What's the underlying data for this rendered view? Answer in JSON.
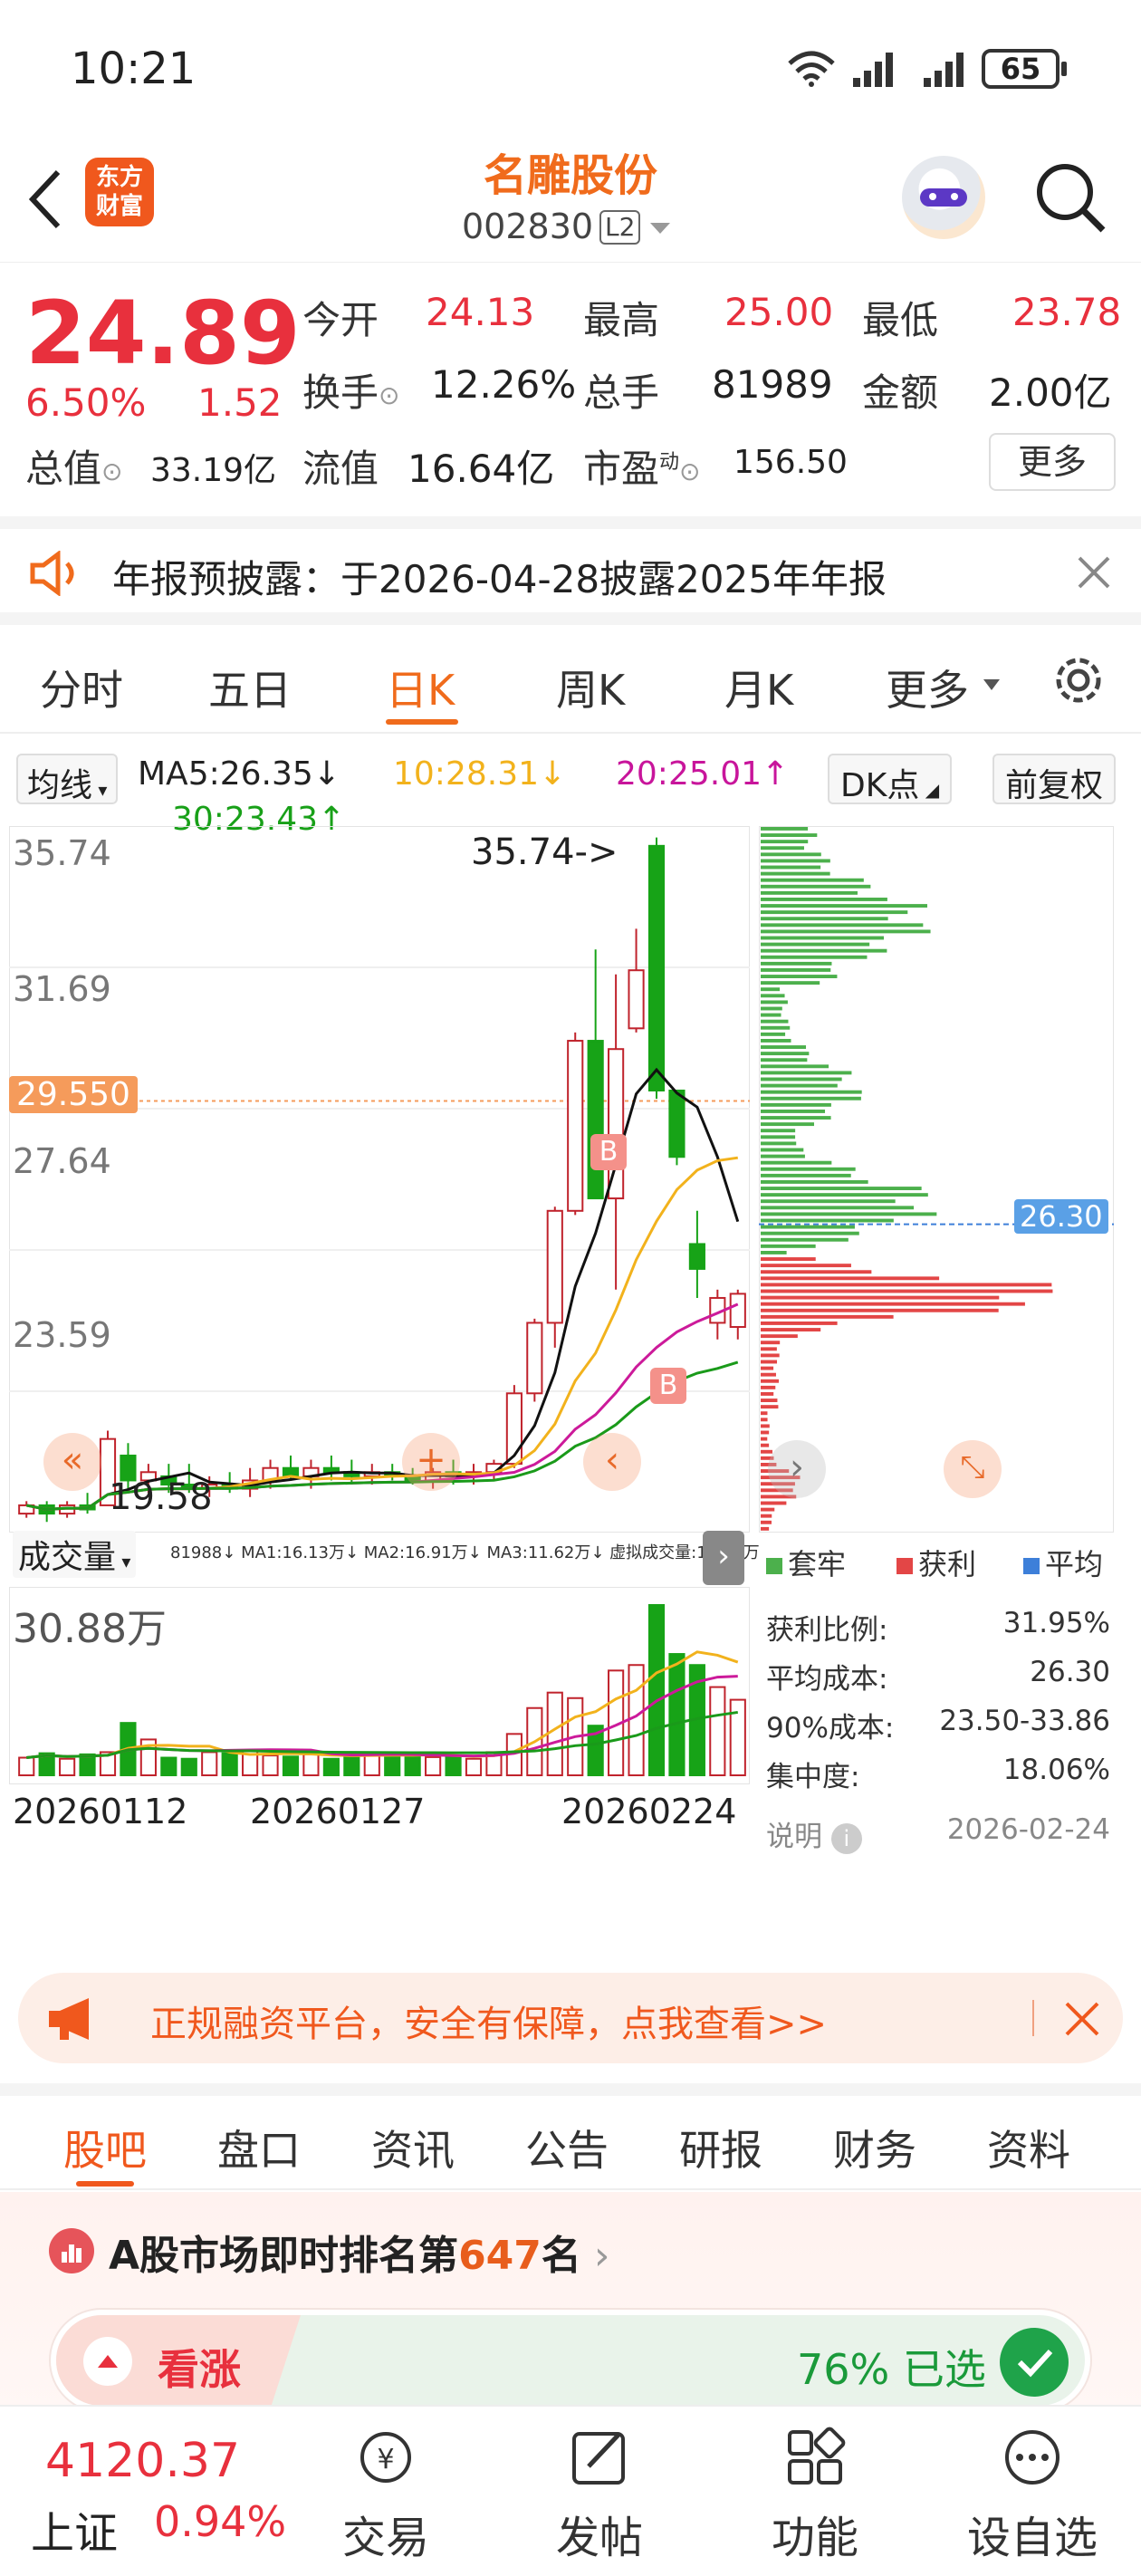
{
  "status": {
    "time": "10:21",
    "battery": "65"
  },
  "nav": {
    "title": "名雕股份",
    "code": "002830",
    "level": "L2",
    "logo_text1": "东方",
    "logo_text2": "财富"
  },
  "quote": {
    "price": "24.89",
    "pct": "6.50%",
    "chg": "1.52",
    "open_label": "今开",
    "open": "24.13",
    "high_label": "最高",
    "high": "25.00",
    "low_label": "最低",
    "low": "23.78",
    "turnover_label": "换手",
    "turnover": "12.26%",
    "vol_label": "总手",
    "vol": "81989",
    "amount_label": "金额",
    "amount": "2.00亿",
    "mcap_label": "总值",
    "mcap": "33.19亿",
    "float_label": "流值",
    "float": "16.64亿",
    "pe_label": "市盈",
    "pe_sup": "动",
    "pe": "156.50",
    "more": "更多"
  },
  "notice": {
    "text": "年报预披露：于2026-04-28披露2025年年报"
  },
  "tabs": [
    "分时",
    "五日",
    "日K",
    "周K",
    "月K",
    "更多"
  ],
  "chart": {
    "ma_select": "均线",
    "ma5": "MA5:26.35↓",
    "ma10": "10:28.31↓",
    "ma20": "20:25.01↑",
    "ma30": "30:23.43↑",
    "dk": "DK点",
    "fq": "前复权",
    "y_labels": [
      "35.74",
      "31.69",
      "27.64",
      "23.59"
    ],
    "cur_price": "29.550",
    "max_mark": "35.74->",
    "min_mark": "19.58",
    "avg_cost_mark": "26.30",
    "b_mark": "B",
    "vol_select": "成交量",
    "vol_line": "81988↓  MA1:16.13万↓  MA2:16.91万↓  MA3:11.62万↓  虚拟成交量:13.70万",
    "vol_max": "30.88万",
    "dates": [
      "20260112",
      "20260127",
      "20260224"
    ],
    "legend": {
      "trapped": "套牢",
      "profit": "获利",
      "avg": "平均"
    },
    "info": [
      {
        "k": "获利比例:",
        "v": "31.95%"
      },
      {
        "k": "平均成本:",
        "v": "26.30"
      },
      {
        "k": "90%成本:",
        "v": "23.50-33.86"
      },
      {
        "k": "集中度:",
        "v": "18.06%"
      },
      {
        "k": "说明",
        "v": "2026-02-24"
      }
    ],
    "colors": {
      "up": "#c0232c",
      "down": "#17a317",
      "ma5": "#111111",
      "ma10": "#f2b21c",
      "ma20": "#cc1a9a",
      "ma30": "#1a9a1a"
    }
  },
  "chart_data": {
    "type": "candlestick",
    "ylim": [
      19.58,
      35.74
    ],
    "candles": [
      [
        19.6,
        19.9,
        19.5,
        19.8
      ],
      [
        19.8,
        19.9,
        19.4,
        19.6
      ],
      [
        19.6,
        19.9,
        19.5,
        19.8
      ],
      [
        19.8,
        20.1,
        19.6,
        19.7
      ],
      [
        19.8,
        21.6,
        19.8,
        21.4
      ],
      [
        21.0,
        21.3,
        20.2,
        20.4
      ],
      [
        20.4,
        20.8,
        20.1,
        20.6
      ],
      [
        20.5,
        20.8,
        20.1,
        20.3
      ],
      [
        20.3,
        20.8,
        20.1,
        20.2
      ],
      [
        20.2,
        20.5,
        20.0,
        20.3
      ],
      [
        20.3,
        20.6,
        20.1,
        20.2
      ],
      [
        20.2,
        20.7,
        20.0,
        20.4
      ],
      [
        20.4,
        20.9,
        20.2,
        20.7
      ],
      [
        20.7,
        21.0,
        20.4,
        20.5
      ],
      [
        20.5,
        20.9,
        20.2,
        20.7
      ],
      [
        20.7,
        21.0,
        20.4,
        20.6
      ],
      [
        20.6,
        20.9,
        20.3,
        20.5
      ],
      [
        20.5,
        20.8,
        20.3,
        20.6
      ],
      [
        20.6,
        20.8,
        20.4,
        20.5
      ],
      [
        20.5,
        20.7,
        20.3,
        20.4
      ],
      [
        20.4,
        20.7,
        20.2,
        20.6
      ],
      [
        20.6,
        20.9,
        20.3,
        20.5
      ],
      [
        20.5,
        20.8,
        20.3,
        20.6
      ],
      [
        20.6,
        20.9,
        20.4,
        20.8
      ],
      [
        20.8,
        22.7,
        20.7,
        22.5
      ],
      [
        22.5,
        24.3,
        22.3,
        24.2
      ],
      [
        24.2,
        27.0,
        23.6,
        26.9
      ],
      [
        26.9,
        31.2,
        26.8,
        31.0
      ],
      [
        31.0,
        33.2,
        27.3,
        27.2
      ],
      [
        27.2,
        32.6,
        25.0,
        30.8
      ],
      [
        31.3,
        33.7,
        31.2,
        32.7
      ],
      [
        35.7,
        35.9,
        29.6,
        29.8
      ],
      [
        29.8,
        29.8,
        28.0,
        28.2
      ],
      [
        26.1,
        26.9,
        24.8,
        25.5
      ],
      [
        24.2,
        25.0,
        23.8,
        24.8
      ],
      [
        24.1,
        25.0,
        23.8,
        24.9
      ]
    ],
    "volume_max": "30.88万"
  },
  "ad": {
    "text": "正规融资平台，安全有保障，点我查看>>"
  },
  "subtabs": [
    "股吧",
    "盘口",
    "资讯",
    "公告",
    "研报",
    "财务",
    "资料"
  ],
  "rank": {
    "text_pre": "A股市场即时排名第",
    "rank": "647",
    "text_post": "名",
    "bull_label": "看涨",
    "pct_text": "76% 已选"
  },
  "bottom": {
    "index_value": "4120.37",
    "index_name": "上证",
    "index_pct": "0.94%",
    "items": [
      "交易",
      "发帖",
      "功能",
      "设自选"
    ]
  }
}
